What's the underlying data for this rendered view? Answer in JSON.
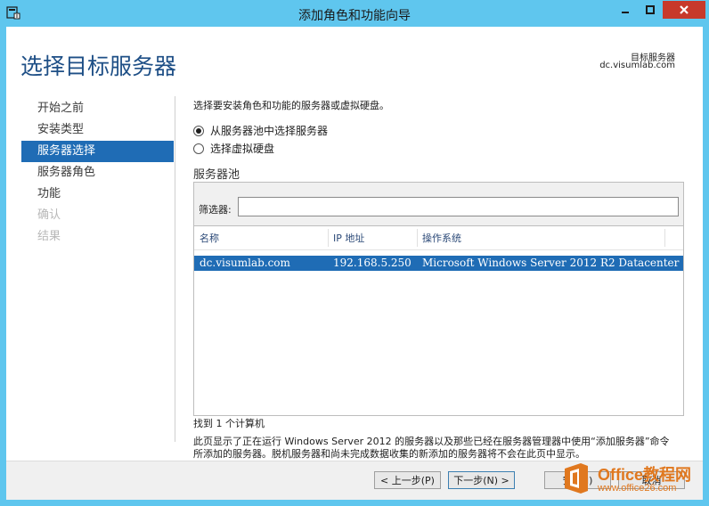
{
  "window": {
    "title": "添加角色和功能向导"
  },
  "header": {
    "title": "选择目标服务器",
    "target_label": "目标服务器",
    "target_value": "dc.visumlab.com"
  },
  "nav": {
    "items": [
      {
        "label": "开始之前",
        "state": "normal"
      },
      {
        "label": "安装类型",
        "state": "normal"
      },
      {
        "label": "服务器选择",
        "state": "active"
      },
      {
        "label": "服务器角色",
        "state": "normal"
      },
      {
        "label": "功能",
        "state": "normal"
      },
      {
        "label": "确认",
        "state": "disabled"
      },
      {
        "label": "结果",
        "state": "disabled"
      }
    ]
  },
  "main": {
    "instruction": "选择要安装角色和功能的服务器或虚拟硬盘。",
    "radio_pool": "从服务器池中选择服务器",
    "radio_vhd": "选择虚拟硬盘",
    "selected_radio": "pool",
    "pool_label": "服务器池",
    "filter_label": "筛选器:",
    "filter_value": "",
    "columns": [
      "名称",
      "IP 地址",
      "操作系统"
    ],
    "rows": [
      {
        "name": "dc.visumlab.com",
        "ip": "192.168.5.250",
        "os": "Microsoft Windows Server 2012 R2 Datacenter"
      }
    ],
    "found_text": "找到 1 个计算机",
    "description": "此页显示了正在运行 Windows Server 2012 的服务器以及那些已经在服务器管理器中使用“添加服务器”命令所添加的服务器。脱机服务器和尚未完成数据收集的新添加的服务器将不会在此页中显示。"
  },
  "footer": {
    "prev_label": "< 上一步(P)",
    "next_label": "下一步(N) >",
    "install_label": "安装(I)",
    "cancel_label": "取消"
  },
  "watermark": {
    "brand": "Office教程网",
    "url": "www.office26.com"
  },
  "colors": {
    "titlebar": "#5fc6ee",
    "accent": "#1f6cb5",
    "close": "#c7392b",
    "heading": "#1e4f86",
    "watermark": "#e0781f"
  }
}
